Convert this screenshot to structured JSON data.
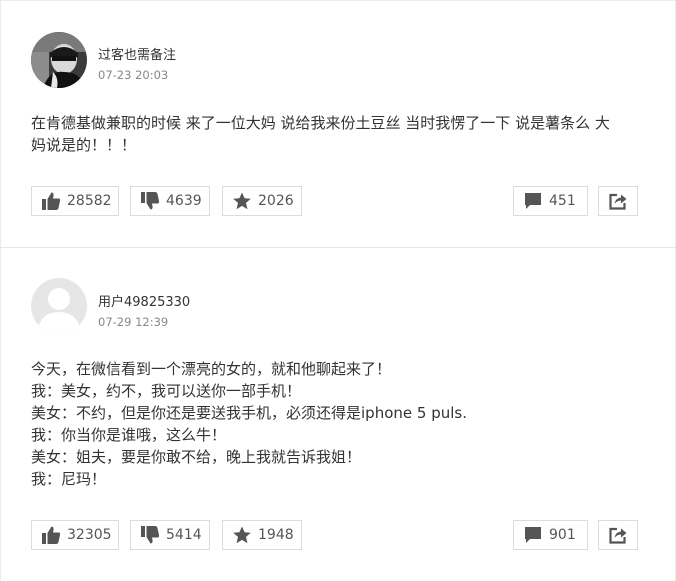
{
  "posts": [
    {
      "username": "过客也需备注",
      "timestamp": "07-23 20:03",
      "content_lines": [
        "在肯德基做兼职的时候 来了一位大妈 说给我来份土豆丝 当时我愣了一下 说是薯条么 大",
        "妈说是的！！！"
      ],
      "likes": "28582",
      "dislikes": "4639",
      "favorites": "2026",
      "comments": "451"
    },
    {
      "username": "用户49825330",
      "timestamp": "07-29 12:39",
      "content_lines": [
        "今天，在微信看到一个漂亮的女的，就和他聊起来了！",
        "我：美女，约不，我可以送你一部手机！",
        "美女：不约，但是你还是要送我手机，必须还得是iphone 5 puls.",
        "我：你当你是谁哦，这么牛！",
        "美女：姐夫，要是你敢不给，晚上我就告诉我姐！",
        "我：尼玛！"
      ],
      "likes": "32305",
      "dislikes": "5414",
      "favorites": "1948",
      "comments": "901"
    }
  ],
  "icons": {
    "like": "thumbs-up-icon",
    "dislike": "thumbs-down-icon",
    "favorite": "star-icon",
    "comment": "comment-bubble-icon",
    "share": "share-icon"
  },
  "colors": {
    "icon": "#555555",
    "border": "#dcdcdc",
    "timestamp": "#888888",
    "text": "#333333"
  }
}
